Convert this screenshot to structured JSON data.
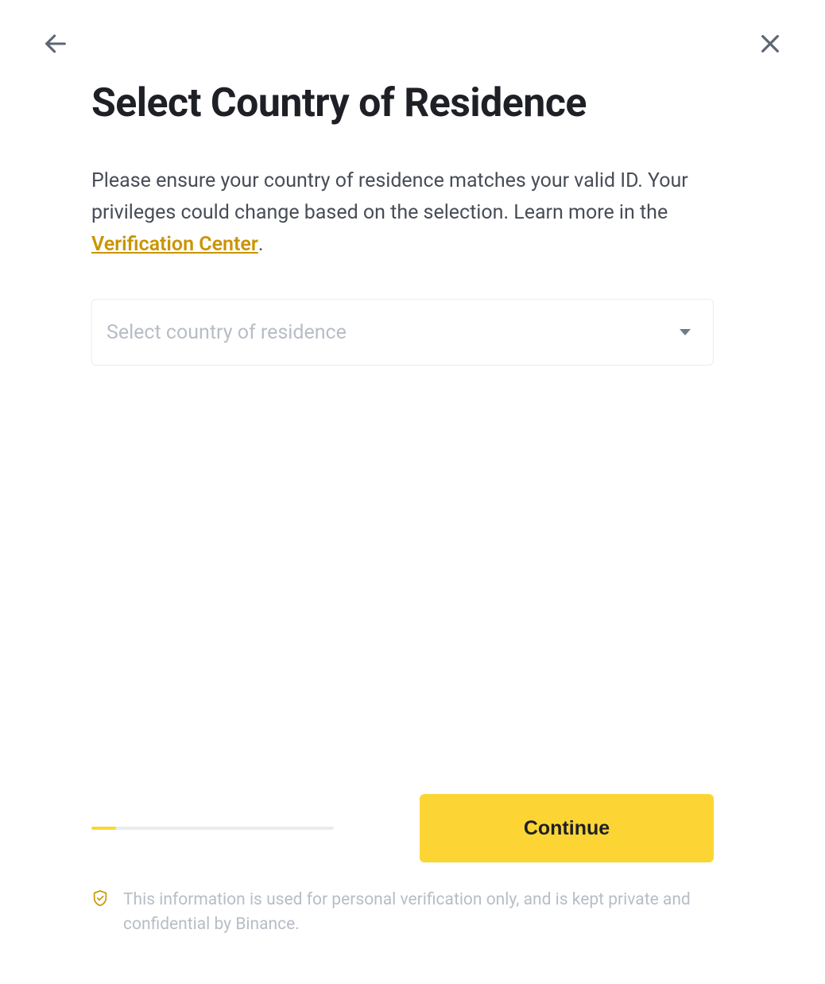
{
  "header": {
    "title": "Select Country of Residence"
  },
  "body": {
    "description_part1": "Please ensure your country of residence matches your valid ID. Your privileges could change based on the selection. Learn more in the ",
    "verification_link_text": "Verification Center",
    "description_part2": "."
  },
  "select": {
    "placeholder": "Select country of residence"
  },
  "actions": {
    "continue_label": "Continue"
  },
  "progress": {
    "percent": 10
  },
  "disclaimer": {
    "text": "This information is used for personal verification only, and is kept private and confidential by Binance."
  }
}
